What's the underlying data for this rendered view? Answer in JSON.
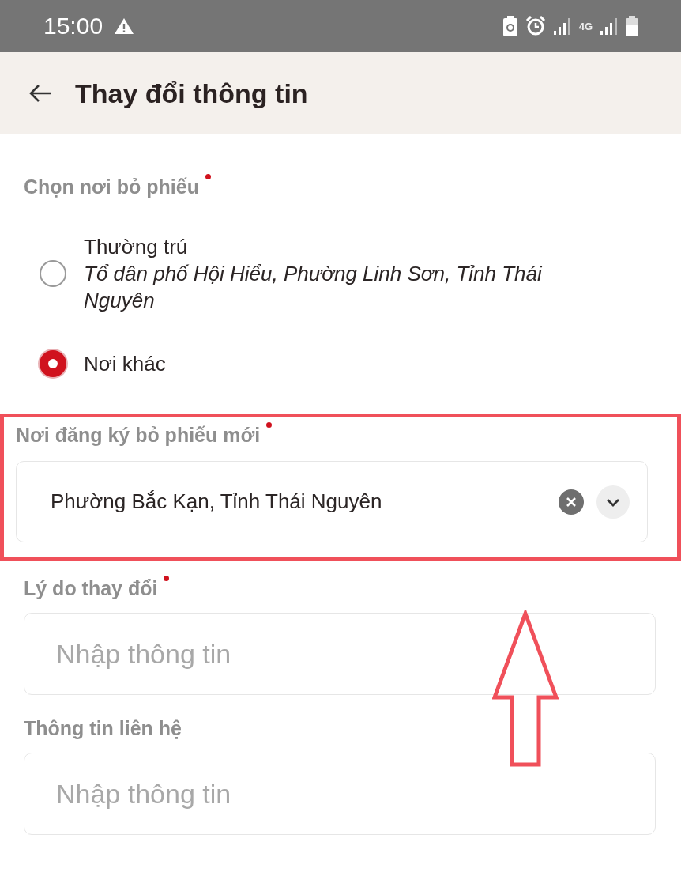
{
  "status_bar": {
    "time": "15:00",
    "network": "4G"
  },
  "header": {
    "title": "Thay đổi thông tin"
  },
  "voting_place": {
    "label": "Chọn nơi bỏ phiếu",
    "required": true,
    "options": [
      {
        "title": "Thường trú",
        "address": "Tổ dân phố Hội Hiểu, Phường Linh Sơn, Tỉnh Thái Nguyên",
        "selected": false
      },
      {
        "title": "Nơi khác",
        "selected": true
      }
    ]
  },
  "fields": [
    {
      "kind": "select",
      "label": "Nơi đăng ký bỏ phiếu mới",
      "required": true,
      "value": "Phường Bắc Kạn, Tỉnh Thái Nguyên",
      "highlighted": true
    },
    {
      "kind": "text",
      "label": "Lý do thay đổi",
      "required": true,
      "placeholder": "Nhập thông tin",
      "highlighted": false
    },
    {
      "kind": "text",
      "label": "Thông tin liên hệ",
      "required": false,
      "placeholder": "Nhập thông tin",
      "highlighted": false
    }
  ]
}
